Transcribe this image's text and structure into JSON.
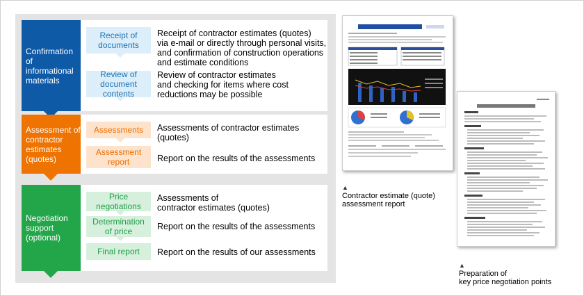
{
  "stages": [
    {
      "title": "Confirmation of\ninformational\nmaterials",
      "color": "#0f5aa6",
      "steps": [
        {
          "tag": "Receipt of\ndocuments",
          "desc": "Receipt of contractor estimates (quotes)\nvia e-mail or directly through personal visits,\nand confirmation of construction operations\nand estimate conditions"
        },
        {
          "tag": "Review of\ndocument contents",
          "desc": "Review of contractor estimates\nand checking for items where cost\nreductions may be possible"
        }
      ]
    },
    {
      "title": "Assessment of\ncontractor\nestimates\n(quotes)",
      "color": "#ee7300",
      "steps": [
        {
          "tag": "Assessments",
          "desc": "Assessments of contractor estimates\n(quotes)"
        },
        {
          "tag": "Assessment\nreport",
          "desc": "Report on the results of the assessments"
        }
      ]
    },
    {
      "title": "Negotiation\nsupport\n(optional)",
      "color": "#23a64a",
      "steps": [
        {
          "tag": "Price\nnegotiations",
          "desc": "Assessments of\ncontractor estimates (quotes)"
        },
        {
          "tag": "Determination\nof price",
          "desc": "Report on the results of the assessments"
        },
        {
          "tag": "Final report",
          "desc": "Report on the results of our assessments"
        }
      ]
    }
  ],
  "captions": {
    "marker": "▲",
    "doc1": "Contractor estimate (quote)\nassessment report",
    "doc2": "Preparation of\nkey price negotiation points"
  }
}
